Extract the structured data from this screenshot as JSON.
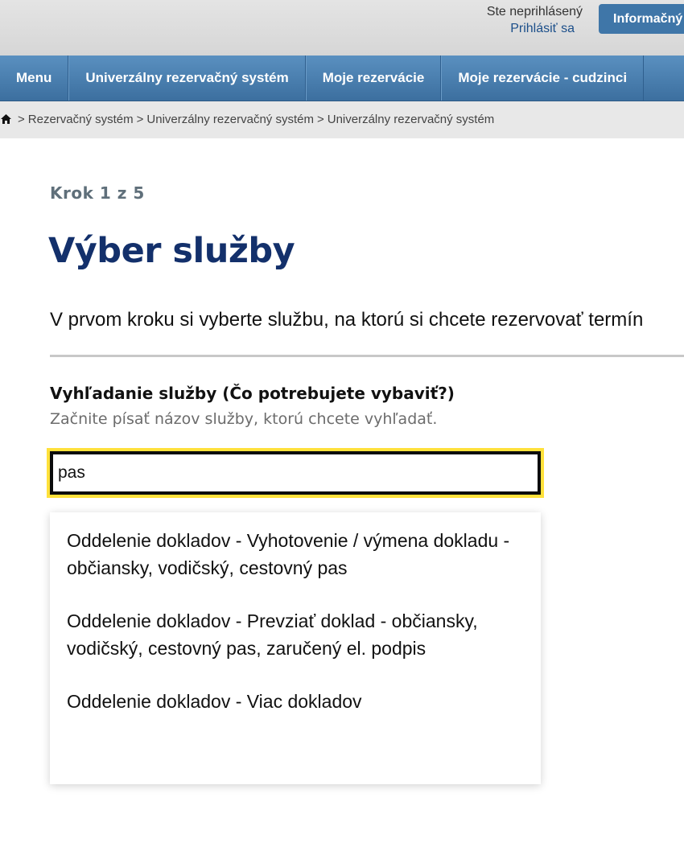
{
  "header": {
    "login_status": "Ste neprihlásený",
    "login_link": "Prihlásiť sa",
    "info_button": "Informačný"
  },
  "nav": {
    "items": [
      {
        "label": "Menu"
      },
      {
        "label": "Univerzálny rezervačný systém"
      },
      {
        "label": "Moje rezervácie"
      },
      {
        "label": "Moje rezervácie - cudzinci"
      }
    ]
  },
  "breadcrumb": {
    "items": [
      "Rezervačný systém",
      "Univerzálny rezervačný systém",
      "Univerzálny rezervačný systém"
    ],
    "separator": ">"
  },
  "main": {
    "step": "Krok 1 z 5",
    "title": "Výber služby",
    "intro": "V prvom kroku si vyberte službu, na ktorú si chcete rezervovať termín",
    "search": {
      "label": "Vyhľadanie služby (Čo potrebujete vybaviť?)",
      "hint": "Začnite písať názov služby, ktorú chcete vyhľadať.",
      "value": "pas"
    },
    "suggestions": [
      "Oddelenie dokladov - Vyhotovenie / výmena dokladu - občiansky, vodičský, cestovný pas",
      "Oddelenie dokladov - Prevziať doklad - občiansky, vodičský, cestovný pas, zaručený el. podpis",
      "Oddelenie dokladov - Viac dokladov"
    ]
  },
  "colors": {
    "nav_blue": "#3c6f9f",
    "title_navy": "#13306b",
    "focus_yellow": "#ffe13b"
  }
}
